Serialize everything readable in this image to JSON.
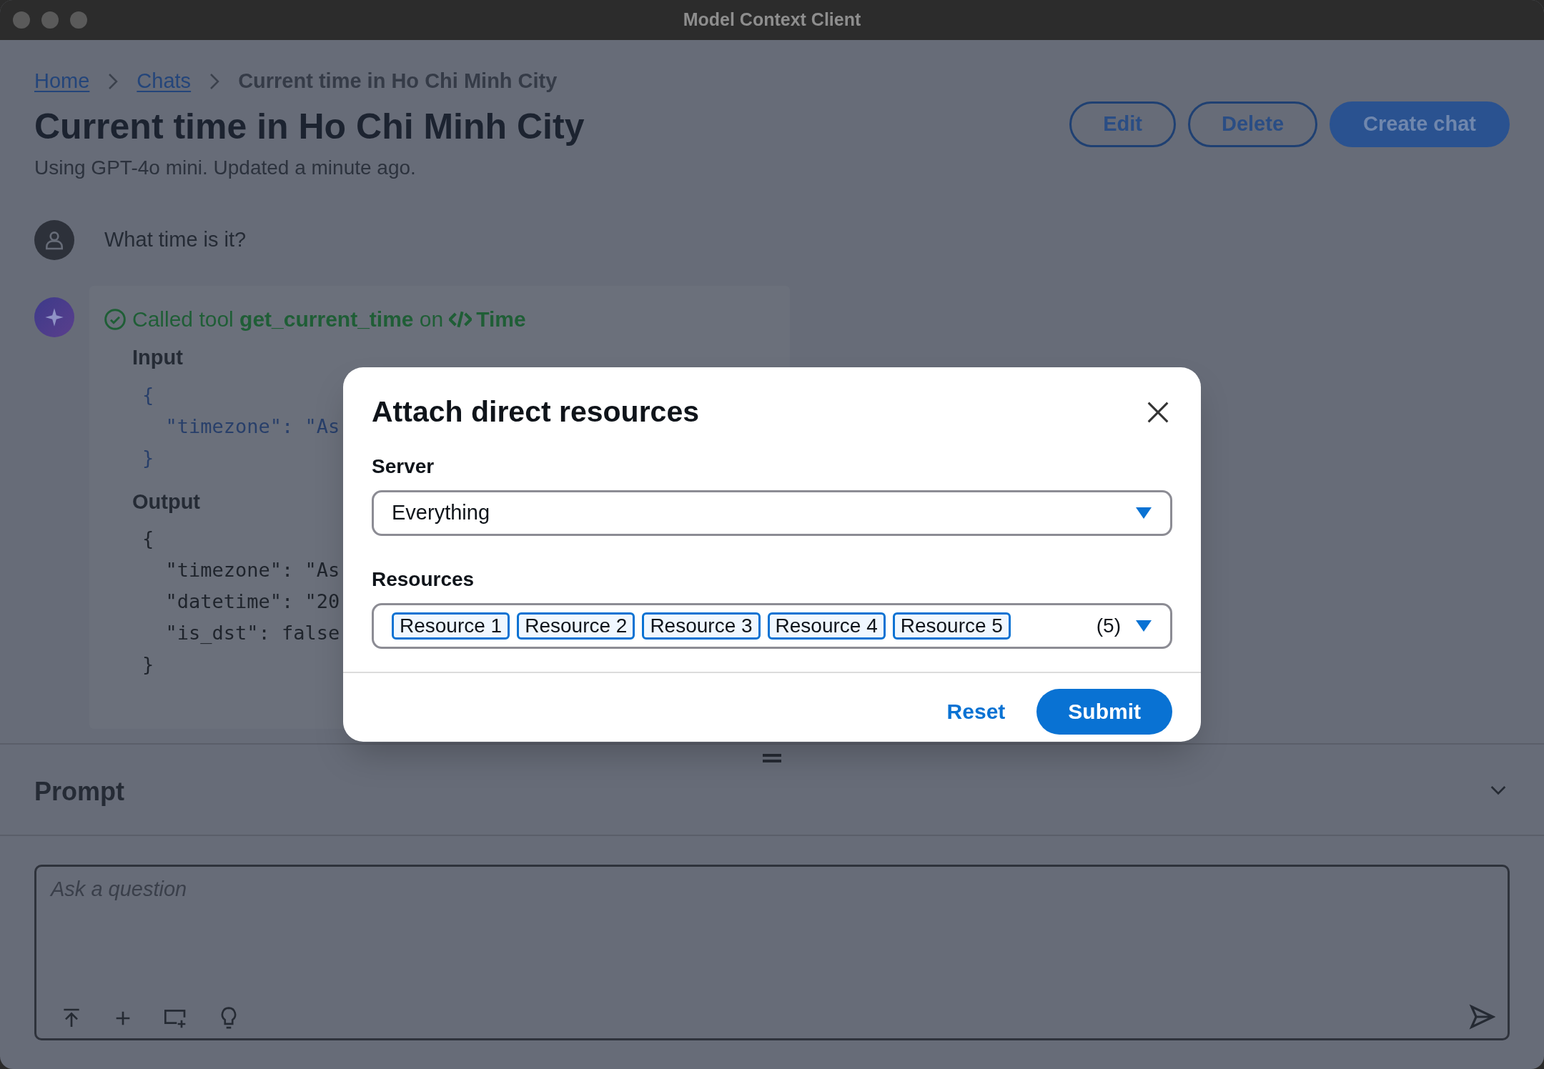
{
  "window": {
    "title": "Model Context Client"
  },
  "breadcrumbs": [
    {
      "label": "Home",
      "kind": "link"
    },
    {
      "label": "Chats",
      "kind": "link"
    },
    {
      "label": "Current time in Ho Chi Minh City",
      "kind": "current"
    }
  ],
  "page": {
    "title": "Current time in Ho Chi Minh City",
    "subtitle": "Using GPT-4o mini. Updated a minute ago."
  },
  "actions": [
    {
      "label": "Edit",
      "kind": "secondary"
    },
    {
      "label": "Delete",
      "kind": "secondary"
    },
    {
      "label": "Create chat",
      "kind": "primary"
    }
  ],
  "user_message": {
    "text": "What time is it?"
  },
  "tool_call": {
    "summary": "Called tool **get_current_time** on",
    "server": "Time",
    "sections": [
      {
        "heading": "Input",
        "highlighted": true,
        "lines": [
          "{",
          "  \"timezone\": \"As",
          "}"
        ]
      },
      {
        "heading": "Output",
        "highlighted": false,
        "lines": [
          "{",
          "  \"timezone\": \"As",
          "  \"datetime\": \"20",
          "  \"is_dst\": false",
          "}"
        ]
      }
    ]
  },
  "prompt": {
    "title": "Prompt",
    "placeholder": "Ask a question"
  },
  "dialog": {
    "title": "Attach direct resources",
    "server_label": "Server",
    "server_value": "Everything",
    "resources_label": "Resources",
    "resources": [
      "Resource 1",
      "Resource 2",
      "Resource 3",
      "Resource 4",
      "Resource 5"
    ],
    "count": "(5)",
    "buttons": [
      {
        "label": "Reset",
        "kind": "link"
      },
      {
        "label": "Submit",
        "kind": "primary"
      }
    ]
  }
}
